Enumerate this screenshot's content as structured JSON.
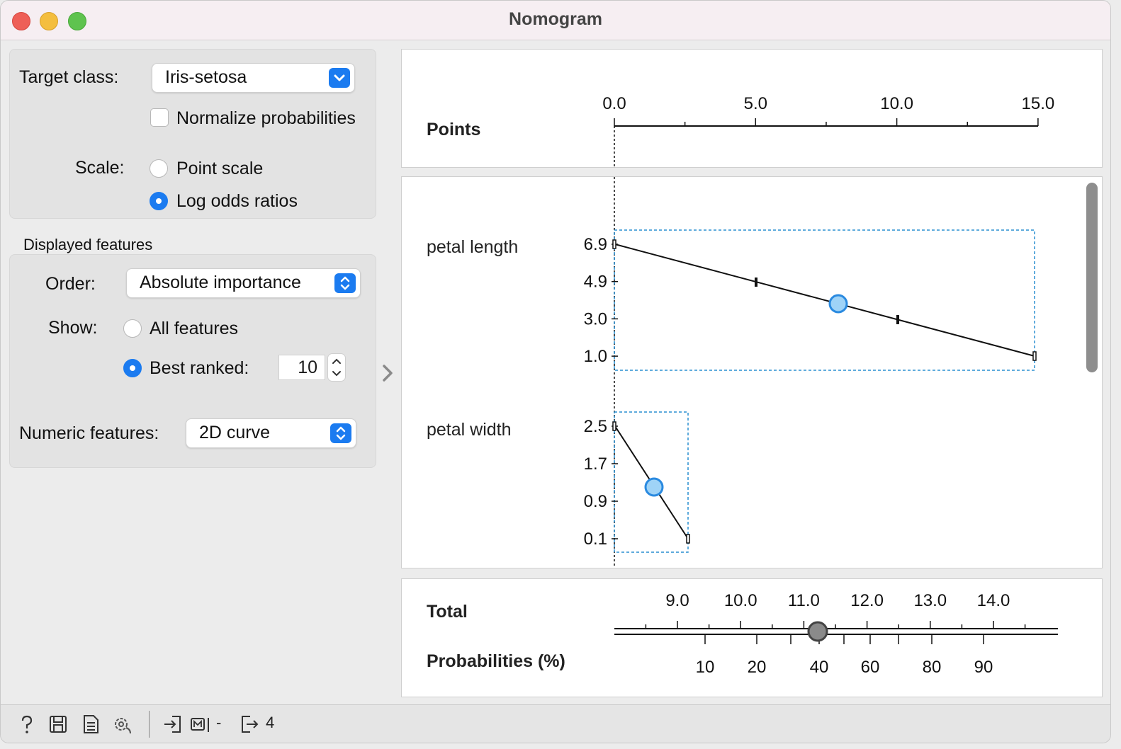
{
  "window": {
    "title": "Nomogram"
  },
  "settings": {
    "target_class_label": "Target class:",
    "target_class_value": "Iris-setosa",
    "normalize_label": "Normalize probabilities",
    "scale_label": "Scale:",
    "scale_options": [
      "Point scale",
      "Log odds ratios"
    ],
    "scale_selected": "Log odds ratios"
  },
  "features": {
    "section_title": "Displayed features",
    "order_label": "Order:",
    "order_value": "Absolute importance",
    "show_label": "Show:",
    "show_all_label": "All features",
    "show_best_label": "Best ranked:",
    "best_ranked_value": "10",
    "numeric_label": "Numeric features:",
    "numeric_value": "2D curve"
  },
  "nomogram": {
    "points_label": "Points",
    "points_ticks": [
      "0.0",
      "5.0",
      "10.0",
      "15.0"
    ],
    "feature_rows": [
      {
        "name": "petal length",
        "values": [
          "6.9",
          "4.9",
          "3.0",
          "1.0"
        ]
      },
      {
        "name": "petal width",
        "values": [
          "2.5",
          "1.7",
          "0.9",
          "0.1"
        ]
      }
    ],
    "total_label": "Total",
    "total_ticks": [
      "9.0",
      "10.0",
      "11.0",
      "12.0",
      "13.0",
      "14.0"
    ],
    "prob_label": "Probabilities (%)",
    "prob_ticks": [
      "10",
      "20",
      "40",
      "60",
      "80",
      "90"
    ]
  },
  "statusbar": {
    "input_text": "-",
    "output_count": "4"
  },
  "colors": {
    "accent": "#1b7bf0",
    "marker_fill": "#9fd3f7",
    "marker_stroke": "#2a8ae0",
    "dotted_box": "#2a8fd0"
  }
}
